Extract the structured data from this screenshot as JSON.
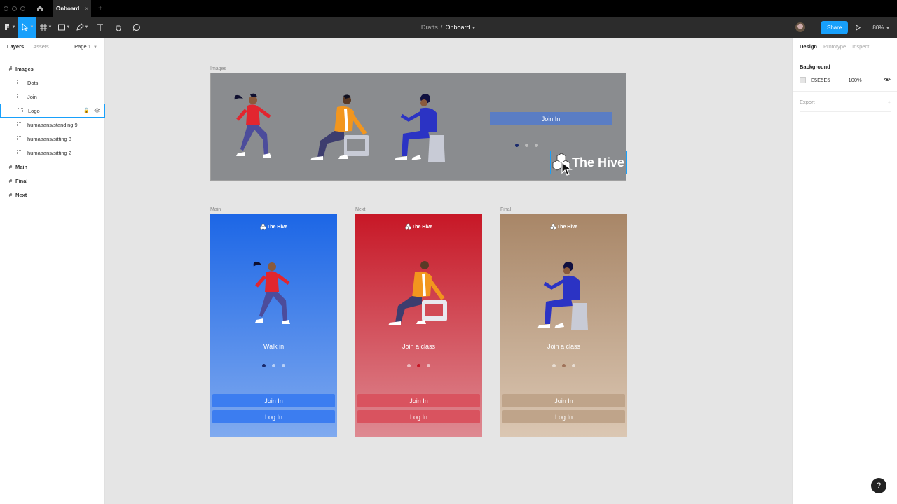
{
  "tabbar": {
    "file_tab": "Onboard",
    "close": "×",
    "new_tab": "+"
  },
  "toolbar": {
    "crumb_folder": "Drafts",
    "crumb_sep": "/",
    "crumb_file": "Onboard",
    "share": "Share",
    "zoom": "80%"
  },
  "left_panel": {
    "tabs": [
      "Layers",
      "Assets"
    ],
    "page": "Page 1",
    "layers": [
      {
        "name": "Images",
        "kind": "frame"
      },
      {
        "name": "Dots",
        "kind": "child"
      },
      {
        "name": "Join",
        "kind": "child"
      },
      {
        "name": "Logo",
        "kind": "child",
        "selected": true
      },
      {
        "name": "humaaans/standing 9",
        "kind": "child"
      },
      {
        "name": "humaaans/sitting 8",
        "kind": "child"
      },
      {
        "name": "humaaans/sitting 2",
        "kind": "child"
      },
      {
        "name": "Main",
        "kind": "frame"
      },
      {
        "name": "Final",
        "kind": "frame"
      },
      {
        "name": "Next",
        "kind": "frame"
      }
    ]
  },
  "right_panel": {
    "tabs": [
      "Design",
      "Prototype",
      "Inspect"
    ],
    "background_label": "Background",
    "bg_hex": "E5E5E5",
    "bg_opacity": "100%",
    "export_label": "Export",
    "export_add": "+"
  },
  "canvas": {
    "images_frame": {
      "label": "Images",
      "join": "Join In",
      "logo": "The Hive"
    },
    "phones": [
      {
        "label": "Main",
        "logo": "The Hive",
        "title": "Walk in",
        "join": "Join In",
        "login": "Log In",
        "active_dot": 0,
        "accent": "#1c66e6",
        "button": "#3c7df0",
        "dot_active": "#1a2a6c"
      },
      {
        "label": "Next",
        "logo": "The Hive",
        "title": "Join a class",
        "join": "Join In",
        "login": "Log In",
        "active_dot": 1,
        "accent": "#c71726",
        "button": "#d9535f",
        "dot_active": "#c71726"
      },
      {
        "label": "Final",
        "logo": "The Hive",
        "title": "Join a class",
        "join": "Join In",
        "login": "Log In",
        "active_dot": 1,
        "accent": "#a88667",
        "button": "#bfa48a",
        "dot_active": "#a0735a"
      }
    ]
  },
  "help": "?",
  "colors": {
    "figma_blue": "#18a0fb",
    "toolbar": "#2c2c2c",
    "canvas": "#e5e5e5"
  }
}
